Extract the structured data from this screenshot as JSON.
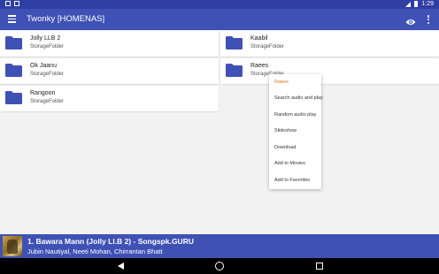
{
  "statusbar": {
    "time": "1:29"
  },
  "appbar": {
    "title": "Twonky [HOMENAS]"
  },
  "items": [
    {
      "name": "Jolly LLB 2",
      "type": "StorageFolder"
    },
    {
      "name": "Kaabil",
      "type": "StorageFolder"
    },
    {
      "name": "Ok Jaanu",
      "type": "StorageFolder"
    },
    {
      "name": "Raees",
      "type": "StorageFolder"
    },
    {
      "name": "Rangoon",
      "type": "StorageFolder"
    }
  ],
  "context_menu": {
    "header": "Raees",
    "items": [
      "Search audio and play",
      "Random audio play",
      "Slideshow",
      "Download",
      "Add to Movies",
      "Add to Favorites"
    ]
  },
  "player": {
    "track": "1. Bawara Mann (Jolly Ll.B 2) - Songspk.GURU",
    "artist": "Jubin Nautiyal, Neeti Mohan, Chirrantan Bhatt"
  },
  "colors": {
    "primary": "#3f51b5",
    "primary_dark": "#2f3ea3",
    "folder": "#3f51b5",
    "menu_header": "#e8711b"
  },
  "icons": {
    "nav": "menu-icon",
    "view": "eye-icon",
    "overflow": "more-vert-icon",
    "folder": "folder-icon"
  }
}
